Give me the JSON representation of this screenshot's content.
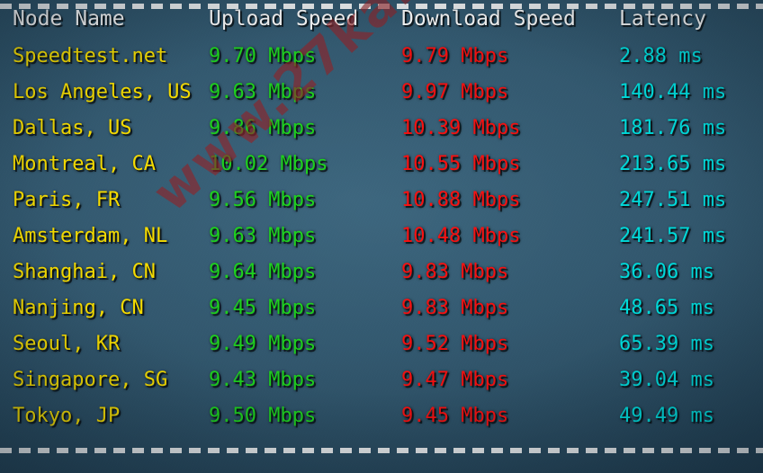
{
  "watermark": {
    "text": "www.27ka.cn"
  },
  "table": {
    "headers": [
      "Node Name",
      "Upload Speed",
      "Download Speed",
      "Latency"
    ],
    "units": {
      "speed": "Mbps",
      "latency": "ms"
    },
    "colors": {
      "background": "#2d5166",
      "header_text": "#ffffff",
      "node_name": "#ffe400",
      "upload": "#1fd61f",
      "download": "#fc1111",
      "latency": "#00e3e3",
      "divider": "#f2f4f5",
      "watermark": "#962428"
    },
    "rows": [
      {
        "node": "Speedtest.net",
        "upload": "9.70 Mbps",
        "download": "9.79 Mbps",
        "latency": "2.88 ms"
      },
      {
        "node": "Los Angeles, US",
        "upload": "9.63 Mbps",
        "download": "9.97 Mbps",
        "latency": "140.44 ms"
      },
      {
        "node": "Dallas, US",
        "upload": "9.86 Mbps",
        "download": "10.39 Mbps",
        "latency": "181.76 ms"
      },
      {
        "node": "Montreal, CA",
        "upload": "10.02 Mbps",
        "download": "10.55 Mbps",
        "latency": "213.65 ms"
      },
      {
        "node": "Paris, FR",
        "upload": "9.56 Mbps",
        "download": "10.88 Mbps",
        "latency": "247.51 ms"
      },
      {
        "node": "Amsterdam, NL",
        "upload": "9.63 Mbps",
        "download": "10.48 Mbps",
        "latency": "241.57 ms"
      },
      {
        "node": "Shanghai, CN",
        "upload": "9.64 Mbps",
        "download": "9.83 Mbps",
        "latency": "36.06 ms"
      },
      {
        "node": "Nanjing, CN",
        "upload": "9.45 Mbps",
        "download": "9.83 Mbps",
        "latency": "48.65 ms"
      },
      {
        "node": "Seoul, KR",
        "upload": "9.49 Mbps",
        "download": "9.52 Mbps",
        "latency": "65.39 ms"
      },
      {
        "node": "Singapore, SG",
        "upload": "9.43 Mbps",
        "download": "9.47 Mbps",
        "latency": "39.04 ms"
      },
      {
        "node": "Tokyo, JP",
        "upload": "9.50 Mbps",
        "download": "9.45 Mbps",
        "latency": "49.49 ms"
      }
    ]
  },
  "chart_data": {
    "type": "table",
    "title": "Speedtest node results",
    "columns": [
      "Node Name",
      "Upload Speed",
      "Download Speed",
      "Latency"
    ],
    "units": [
      "",
      "Mbps",
      "Mbps",
      "ms"
    ],
    "categories": [
      "Speedtest.net",
      "Los Angeles, US",
      "Dallas, US",
      "Montreal, CA",
      "Paris, FR",
      "Amsterdam, NL",
      "Shanghai, CN",
      "Nanjing, CN",
      "Seoul, KR",
      "Singapore, SG",
      "Tokyo, JP"
    ],
    "series": [
      {
        "name": "Upload Speed",
        "unit": "Mbps",
        "values": [
          9.7,
          9.63,
          9.86,
          10.02,
          9.56,
          9.63,
          9.64,
          9.45,
          9.49,
          9.43,
          9.5
        ]
      },
      {
        "name": "Download Speed",
        "unit": "Mbps",
        "values": [
          9.79,
          9.97,
          10.39,
          10.55,
          10.88,
          10.48,
          9.83,
          9.83,
          9.52,
          9.47,
          9.45
        ]
      },
      {
        "name": "Latency",
        "unit": "ms",
        "values": [
          2.88,
          140.44,
          181.76,
          213.65,
          247.51,
          241.57,
          36.06,
          48.65,
          65.39,
          39.04,
          49.49
        ]
      }
    ]
  }
}
